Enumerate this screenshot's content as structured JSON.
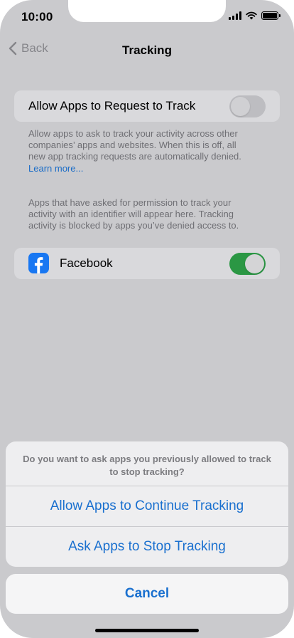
{
  "status_bar": {
    "time": "10:00"
  },
  "nav": {
    "back_label": "Back",
    "title": "Tracking"
  },
  "allow_request": {
    "label": "Allow Apps to Request to Track",
    "enabled": false,
    "footnote": "Allow apps to ask to track your activity across other companies’ apps and websites. When this is off, all new app tracking requests are automatically denied.",
    "learn_more": "Learn more..."
  },
  "apps_info": "Apps that have asked for permission to track your activity with an identifier will appear here. Tracking activity is blocked by apps you’ve denied access to.",
  "apps": [
    {
      "name": "Facebook",
      "icon": "facebook-icon",
      "enabled": true
    }
  ],
  "action_sheet": {
    "message": "Do you want to ask apps you previously allowed to track to stop tracking?",
    "actions": [
      "Allow Apps to Continue Tracking",
      "Ask Apps to Stop Tracking"
    ],
    "cancel": "Cancel"
  },
  "colors": {
    "accent": "#1a70cf",
    "toggle_on": "#2b9744",
    "facebook": "#1877f2"
  }
}
